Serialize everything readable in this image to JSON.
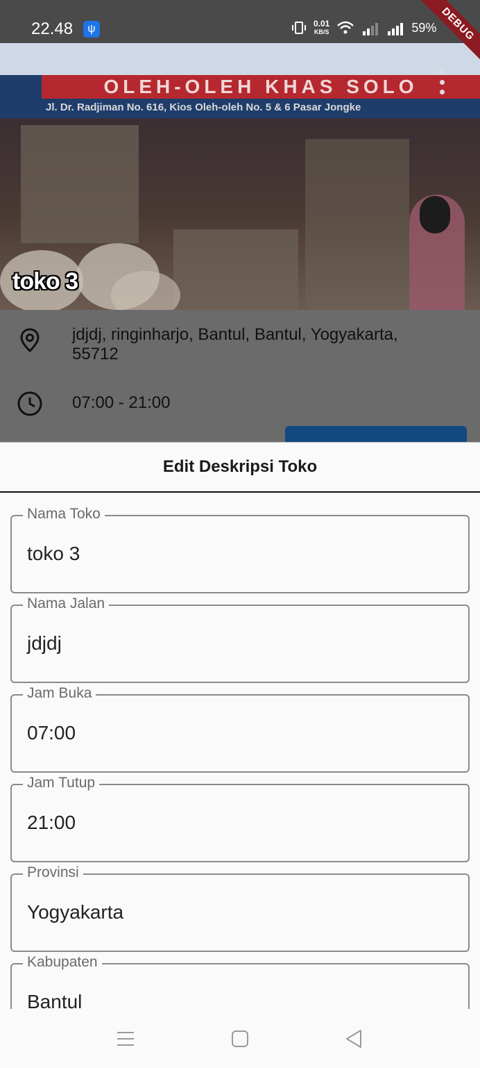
{
  "status_bar": {
    "time": "22.48",
    "net_speed_value": "0.01",
    "net_speed_unit": "KB/S",
    "battery": "59%",
    "debug_banner": "DEBUG"
  },
  "store": {
    "name": "toko 3",
    "sign_text": "OLEH-OLEH KHAS SOLO",
    "sign_address": "Jl. Dr. Radjiman No. 616, Kios Oleh-oleh No. 5 & 6 Pasar Jongke",
    "address_line1": "jdjdj, ringinharjo, Bantul, Bantul, Yogyakarta,",
    "address_line2": "55712",
    "hours": "07:00 - 21:00"
  },
  "sheet": {
    "title": "Edit Deskripsi Toko",
    "fields": [
      {
        "label": "Nama Toko",
        "value": "toko 3"
      },
      {
        "label": "Nama Jalan",
        "value": "jdjdj"
      },
      {
        "label": "Jam Buka",
        "value": "07:00"
      },
      {
        "label": "Jam Tutup",
        "value": "21:00"
      },
      {
        "label": "Provinsi",
        "value": "Yogyakarta"
      },
      {
        "label": "Kabupaten",
        "value": "Bantul"
      }
    ]
  },
  "icons": {
    "location": "location-pin-icon",
    "clock": "clock-icon",
    "menu": "more-vert-icon",
    "nav_recent": "menu-lines-icon",
    "nav_home": "square-icon",
    "nav_back": "triangle-back-icon"
  }
}
